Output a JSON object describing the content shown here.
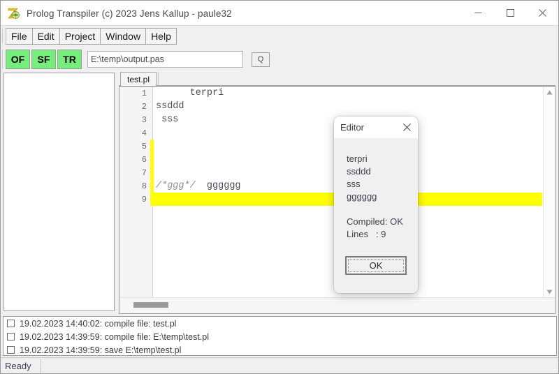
{
  "window": {
    "title": "Prolog Transpiler (c) 2023 Jens Kallup - paule32",
    "icon": "app-logo-icon",
    "controls": {
      "minimize": "minimize-icon",
      "maximize": "maximize-icon",
      "close": "close-icon"
    }
  },
  "menubar": {
    "items": [
      {
        "label": "File"
      },
      {
        "label": "Edit"
      },
      {
        "label": "Project"
      },
      {
        "label": "Window"
      },
      {
        "label": "Help"
      }
    ]
  },
  "toolbar": {
    "buttons": [
      {
        "label": "OF",
        "color": "#76ee7b"
      },
      {
        "label": "SF",
        "color": "#76ee7b"
      },
      {
        "label": "TR",
        "color": "#76ee7b"
      }
    ],
    "path_field": {
      "value": "E:\\temp\\output.pas",
      "placeholder": ""
    },
    "query_button": {
      "label": "Q"
    }
  },
  "left_panel": {
    "items": []
  },
  "editor": {
    "tabs": [
      {
        "label": "test.pl",
        "active": true
      }
    ],
    "change_bar_color": "#ffff00",
    "highlight_color": "#ffff00",
    "lines": [
      {
        "number": "1",
        "text": "      terpri",
        "highlighted": false,
        "changed": false
      },
      {
        "number": "2",
        "text": "ssddd",
        "highlighted": false,
        "changed": false
      },
      {
        "number": "3",
        "text": " sss",
        "highlighted": false,
        "changed": false
      },
      {
        "number": "4",
        "text": "",
        "highlighted": false,
        "changed": false
      },
      {
        "number": "5",
        "text": "",
        "highlighted": false,
        "changed": true
      },
      {
        "number": "6",
        "text": "",
        "highlighted": false,
        "changed": true
      },
      {
        "number": "7",
        "text": "",
        "highlighted": false,
        "changed": true
      },
      {
        "number": "8",
        "comment": "/*ggg*/",
        "text": "  gggggg",
        "highlighted": false,
        "changed": true
      },
      {
        "number": "9",
        "text": "",
        "highlighted": true,
        "changed": true
      }
    ]
  },
  "log": {
    "rows": [
      {
        "text": "19.02.2023 14:40:02: compile file: test.pl",
        "checked": false
      },
      {
        "text": "19.02.2023 14:39:59: compile file: E:\\temp\\test.pl",
        "checked": false
      },
      {
        "text": "19.02.2023 14:39:59: save E:\\temp\\test.pl",
        "checked": false
      }
    ]
  },
  "statusbar": {
    "text": "Ready",
    "second_cell": ""
  },
  "dialog": {
    "title": "Editor",
    "close_label": "close-icon",
    "lines": [
      "terpri",
      "ssddd",
      "sss",
      "gggggg"
    ],
    "compiled_status": "Compiled: OK",
    "lines_count": "Lines   : 9",
    "ok_button": "OK"
  }
}
